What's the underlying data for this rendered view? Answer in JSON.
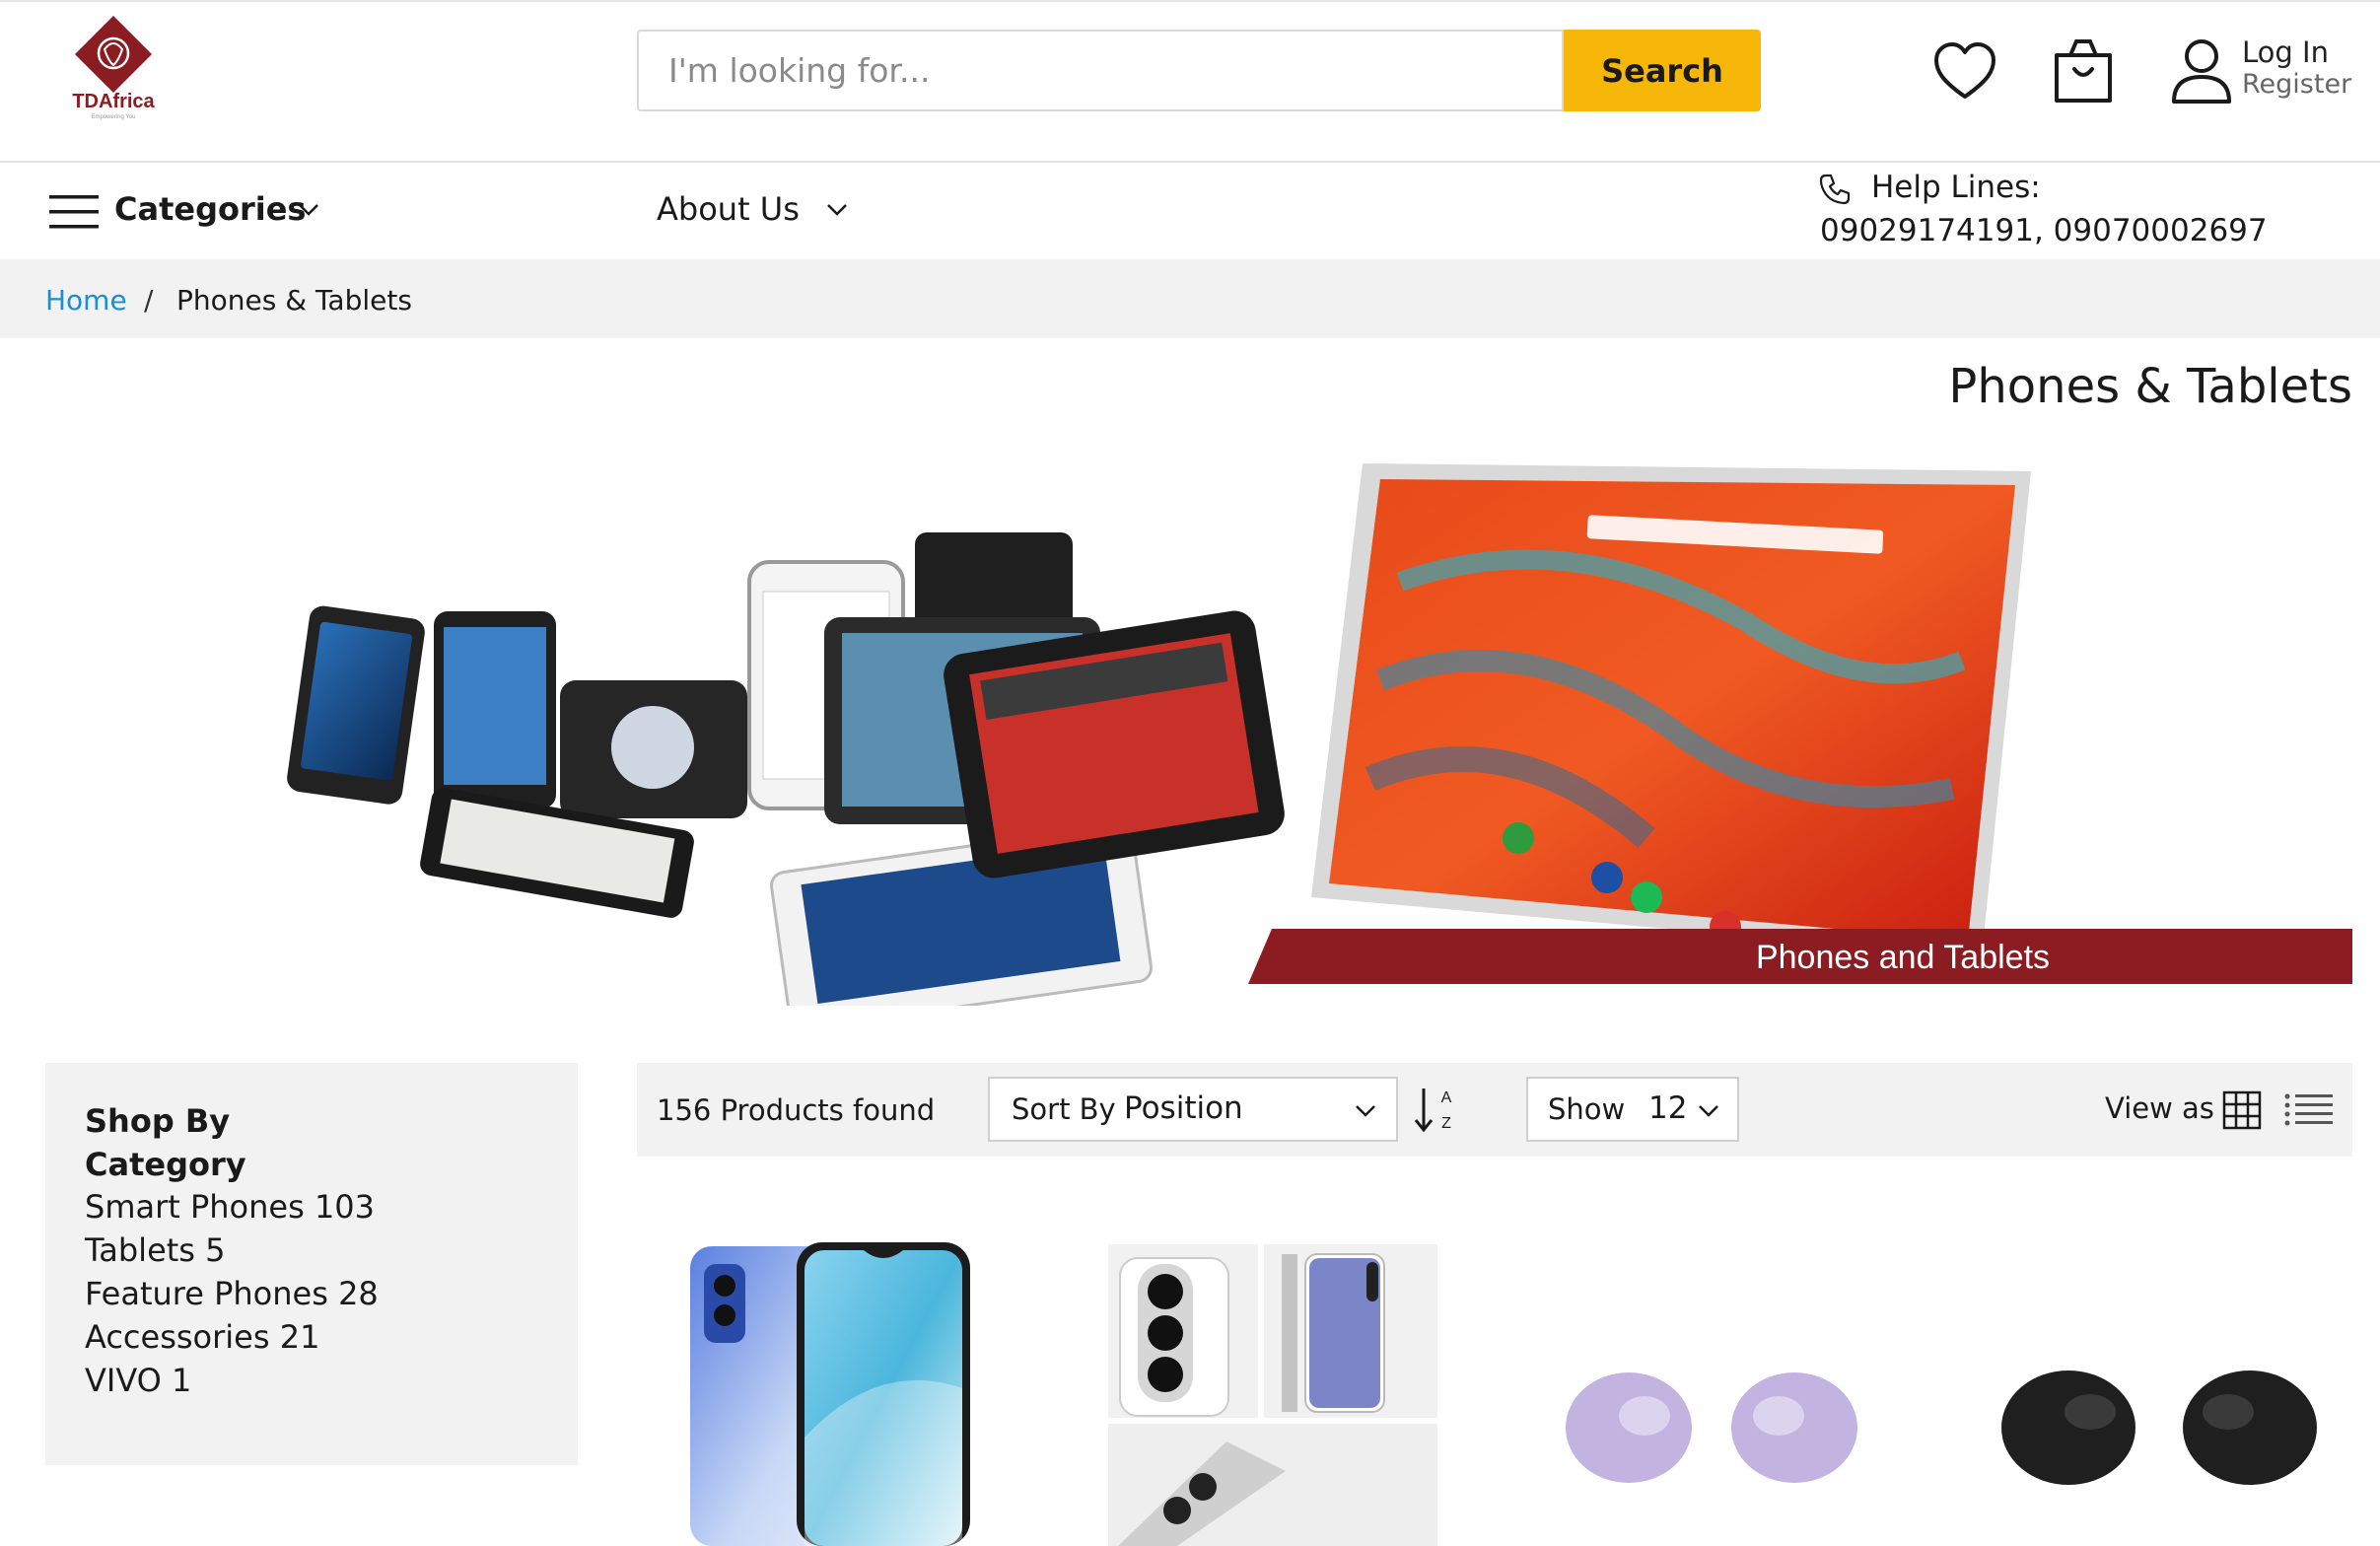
{
  "header": {
    "logo_text": "TDAfrica",
    "search_placeholder": "I'm looking for...",
    "search_button_label": "Search",
    "login_label": "Log In",
    "register_label": "Register"
  },
  "nav": {
    "categories_label": "Categories",
    "about_label": "About Us",
    "help_lines": "Help Lines: 09029174191, 09070002697"
  },
  "breadcrumb": {
    "home": "Home",
    "separator": "/",
    "current": "Phones & Tablets"
  },
  "page": {
    "title": "Phones & Tablets",
    "banner_caption": "Phones and Tablets"
  },
  "sidebar": {
    "title": "Shop By Category",
    "items": [
      {
        "label": "Smart Phones 103"
      },
      {
        "label": "Tablets 5"
      },
      {
        "label": "Feature Phones 28"
      },
      {
        "label": "Accessories 21"
      },
      {
        "label": "VIVO 1"
      }
    ]
  },
  "toolbar": {
    "products_found": "156 Products found",
    "sort_label": "Sort By",
    "sort_value": "Position",
    "show_label": "Show",
    "show_value": "12",
    "view_as_label": "View as"
  },
  "colors": {
    "accent": "#f7b709",
    "brand_red": "#8b1d22",
    "link_blue": "#1a8fd1",
    "panel_gray": "#f2f2f2"
  }
}
